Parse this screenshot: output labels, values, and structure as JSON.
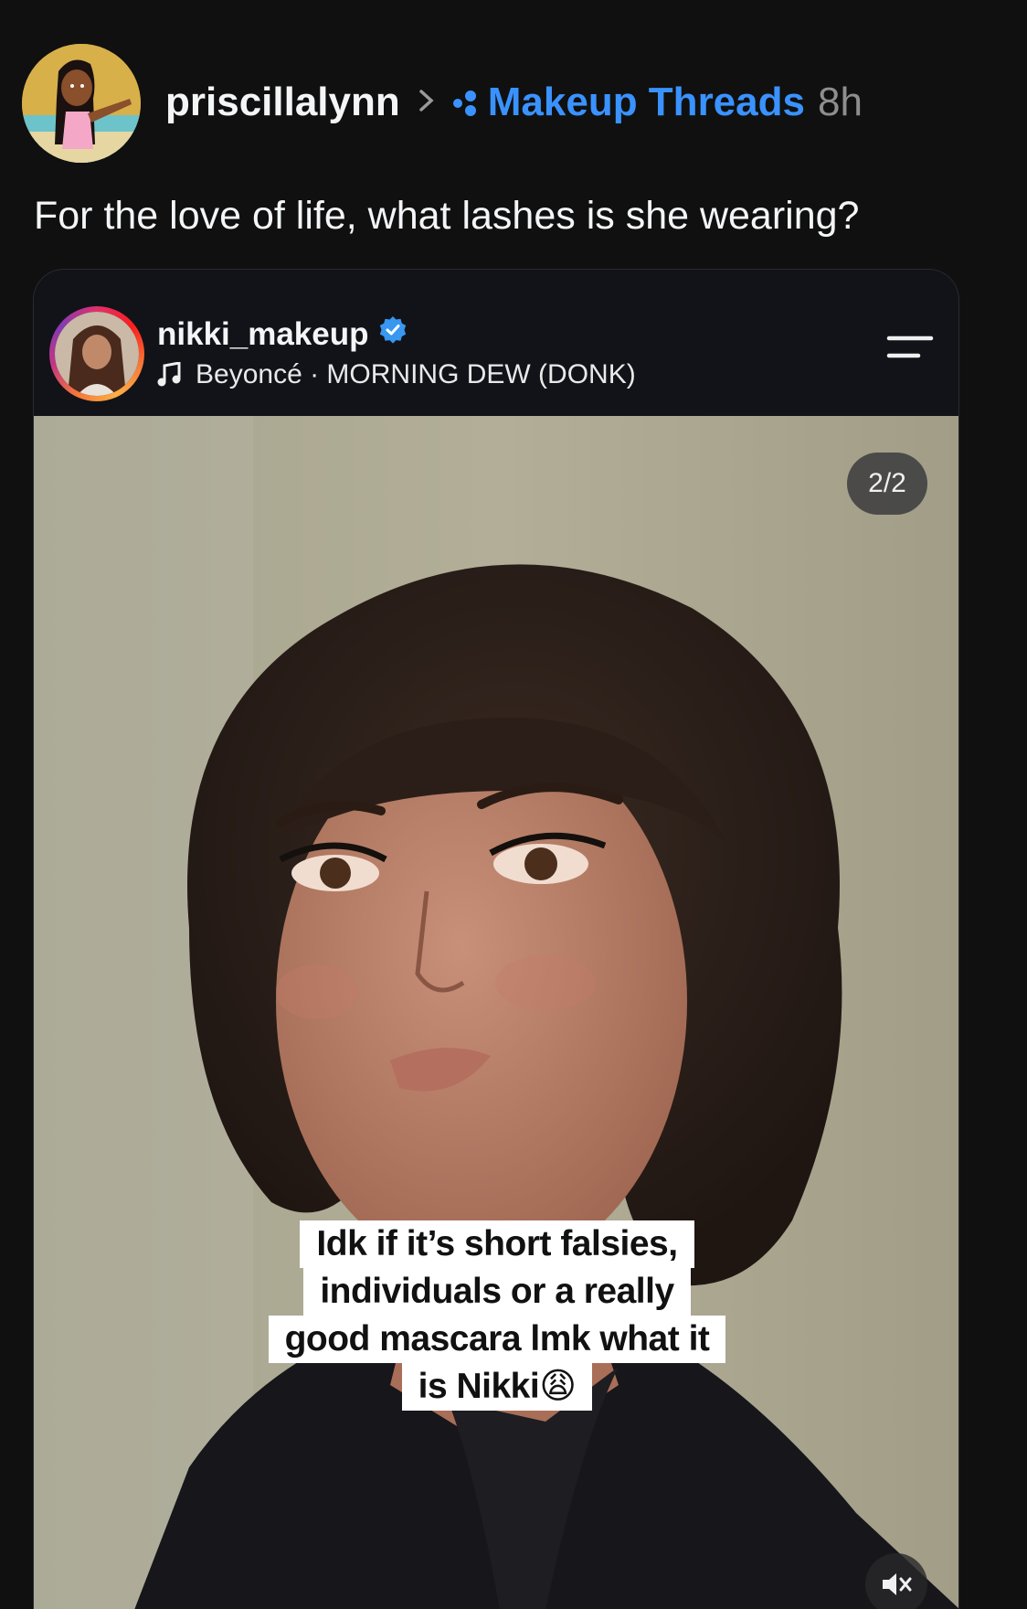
{
  "post": {
    "username": "priscillalynn",
    "community": "Makeup Threads",
    "time": "8h",
    "text": "For the love of life, what lashes is she wearing?"
  },
  "embed": {
    "username": "nikki_makeup",
    "song": "Beyoncé · MORNING DEW (DONK)",
    "counter": "2/2",
    "caption_lines": [
      "Idk if it’s short falsies,",
      "individuals or a really",
      "good mascara lmk what it",
      "is Nikki😩"
    ]
  },
  "icons": {
    "chevron": "chevron-right-icon",
    "community": "community-dots-icon",
    "verified": "verified-badge-icon",
    "music": "music-note-icon",
    "menu": "menu-lines-icon",
    "mute": "speaker-muted-icon"
  },
  "colors": {
    "background": "#101010",
    "community_link": "#3a92ff",
    "verified": "#3897f0"
  }
}
